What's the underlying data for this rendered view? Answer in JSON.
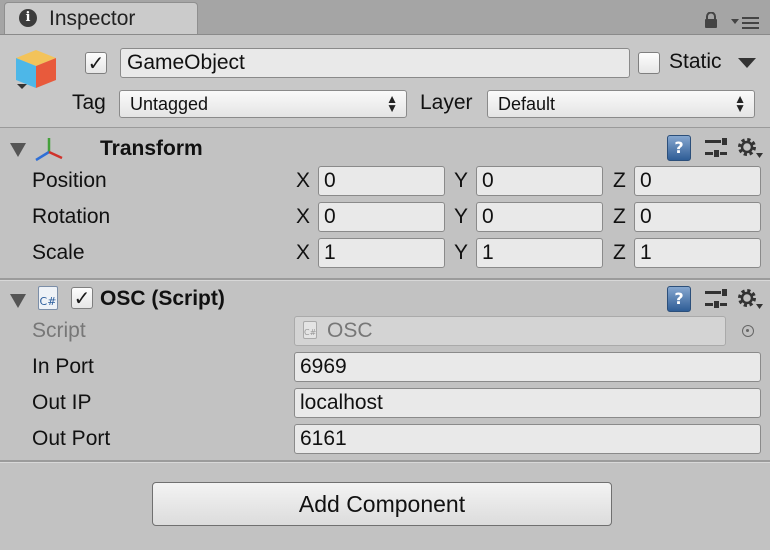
{
  "tab": {
    "title": "Inspector"
  },
  "header": {
    "active": true,
    "name": "GameObject",
    "static_label": "Static",
    "tag_label": "Tag",
    "tag_value": "Untagged",
    "layer_label": "Layer",
    "layer_value": "Default"
  },
  "transform": {
    "title": "Transform",
    "rows": [
      {
        "label": "Position",
        "x": "0",
        "y": "0",
        "z": "0"
      },
      {
        "label": "Rotation",
        "x": "0",
        "y": "0",
        "z": "0"
      },
      {
        "label": "Scale",
        "x": "1",
        "y": "1",
        "z": "1"
      }
    ],
    "axis": {
      "x": "X",
      "y": "Y",
      "z": "Z"
    }
  },
  "osc": {
    "title": "OSC (Script)",
    "script_label": "Script",
    "script_value": "OSC",
    "in_port_label": "In Port",
    "in_port_value": "6969",
    "out_ip_label": "Out IP",
    "out_ip_value": "localhost",
    "out_port_label": "Out Port",
    "out_port_value": "6161"
  },
  "footer": {
    "add_component_label": "Add Component"
  },
  "icons": {
    "tab": "info-icon",
    "lock": "lock-icon",
    "menu": "context-menu-icon",
    "gameobject": "cube-icon",
    "transform": "transform-axes-icon",
    "script": "csharp-file-icon",
    "help": "help-icon",
    "preset": "preset-icon",
    "settings": "gear-icon"
  },
  "colors": {
    "panel": "#c2c2c2",
    "help_blue": "#2f5d96",
    "axis_red": "#d0322b",
    "axis_green": "#45a03b",
    "axis_blue": "#2f6fd6"
  }
}
